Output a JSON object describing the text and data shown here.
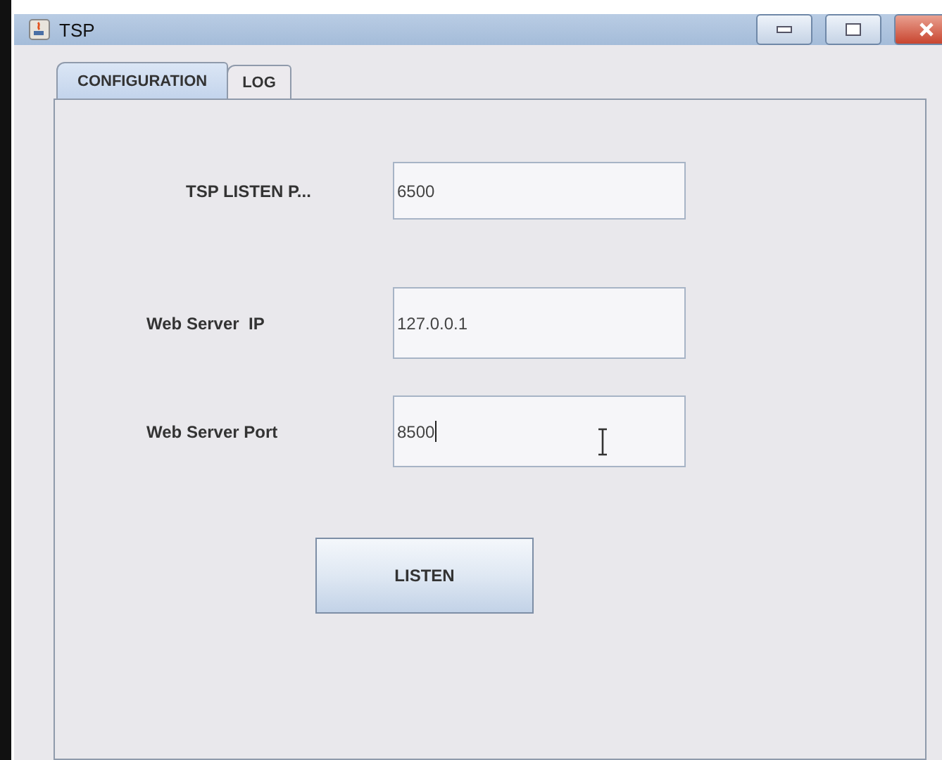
{
  "window": {
    "title": "TSP"
  },
  "tabs": [
    {
      "label": "CONFIGURATION",
      "selected": true
    },
    {
      "label": "LOG",
      "selected": false
    }
  ],
  "fields": [
    {
      "label": "TSP LISTEN P...",
      "value": "6500"
    },
    {
      "label": "Web Server  IP",
      "value": "127.0.0.1"
    },
    {
      "label": "Web Server Port",
      "value": "8500"
    }
  ],
  "button": "LISTEN"
}
